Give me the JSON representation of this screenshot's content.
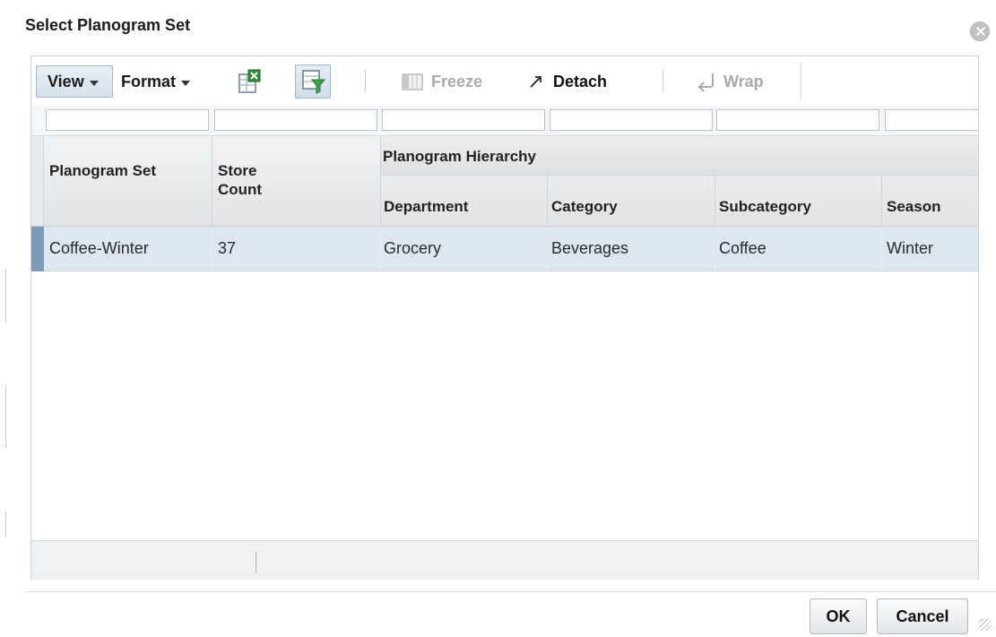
{
  "dialog": {
    "title": "Select Planogram Set"
  },
  "toolbar": {
    "view_label": "View",
    "format_label": "Format",
    "freeze_label": "Freeze",
    "detach_label": "Detach",
    "wrap_label": "Wrap",
    "icons": [
      "export-to-excel-icon",
      "query-by-example-icon",
      "freeze-icon",
      "detach-icon",
      "wrap-icon"
    ]
  },
  "table": {
    "group_header": "Planogram Hierarchy",
    "columns": {
      "planogram_set": "Planogram Set",
      "store_count": "Store Count",
      "department": "Department",
      "category": "Category",
      "subcategory": "Subcategory",
      "season": "Season"
    },
    "rows": [
      {
        "planogram_set": "Coffee-Winter",
        "store_count": "37",
        "department": "Grocery",
        "category": "Beverages",
        "subcategory": "Coffee",
        "season": "Winter"
      }
    ]
  },
  "buttons": {
    "ok": "OK",
    "cancel": "Cancel"
  },
  "colors": {
    "selected_row": "#dde7f2",
    "row_selector": "#7d9ab7",
    "disabled_text": "#a9a9a9"
  }
}
